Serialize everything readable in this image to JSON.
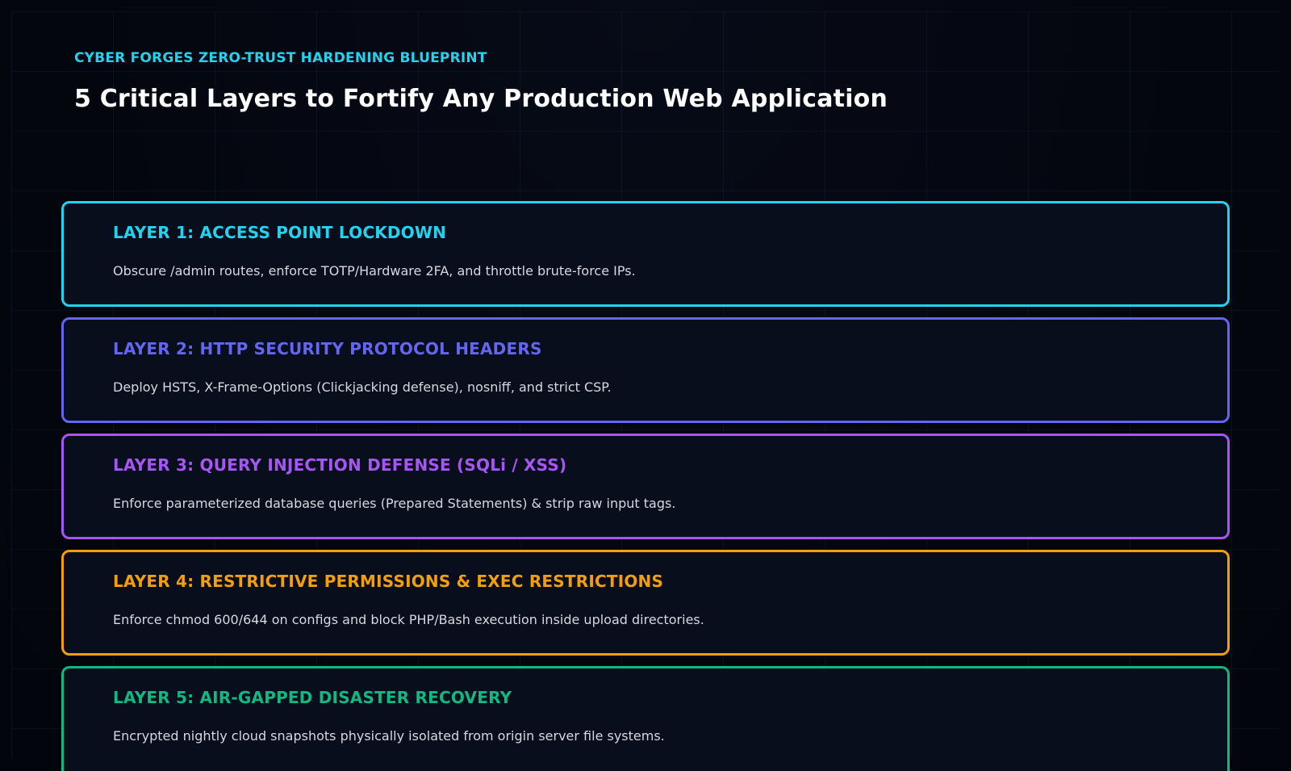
{
  "header": {
    "eyebrow": "CYBER FORGES ZERO-TRUST HARDENING BLUEPRINT",
    "eyebrow_color": "#22d3ee",
    "title": "5 Critical Layers to Fortify Any Production Web Application"
  },
  "layers": [
    {
      "title": "LAYER 1: ACCESS POINT LOCKDOWN",
      "description": "Obscure /admin routes, enforce TOTP/Hardware 2FA, and throttle brute-force IPs.",
      "color": "#22d3ee"
    },
    {
      "title": "LAYER 2: HTTP SECURITY PROTOCOL HEADERS",
      "description": "Deploy HSTS, X-Frame-Options (Clickjacking defense), nosniff, and strict CSP.",
      "color": "#6366f1"
    },
    {
      "title": "LAYER 3: QUERY INJECTION DEFENSE (SQLi / XSS)",
      "description": "Enforce parameterized database queries (Prepared Statements) & strip raw input tags.",
      "color": "#a855f7"
    },
    {
      "title": "LAYER 4: RESTRICTIVE PERMISSIONS & EXEC RESTRICTIONS",
      "description": "Enforce chmod 600/644 on configs and block PHP/Bash execution inside upload directories.",
      "color": "#f59e0b"
    },
    {
      "title": "LAYER 5: AIR-GAPPED DISASTER RECOVERY",
      "description": "Encrypted nightly cloud snapshots physically isolated from origin server file systems.",
      "color": "#10b981"
    }
  ]
}
